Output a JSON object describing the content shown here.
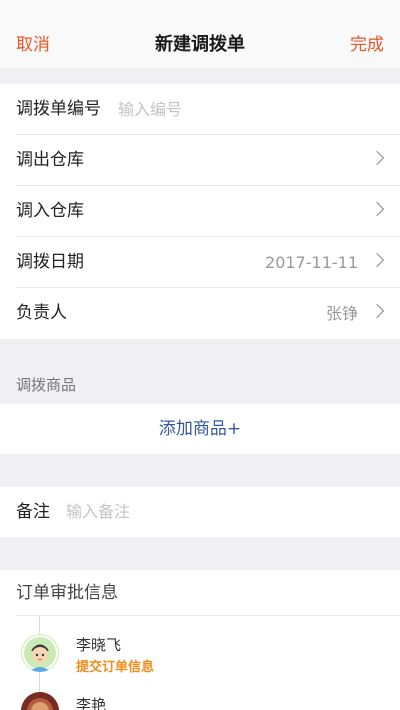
{
  "navbar": {
    "cancel_label": "取消",
    "title": "新建调拨单",
    "done_label": "完成"
  },
  "form": {
    "order_number": {
      "label": "调拨单编号",
      "placeholder": "输入编号"
    },
    "out_warehouse": {
      "label": "调出仓库"
    },
    "in_warehouse": {
      "label": "调入仓库"
    },
    "transfer_date": {
      "label": "调拨日期",
      "value": "2017-11-11"
    },
    "person_in_charge": {
      "label": "负责人",
      "value": "张铮"
    }
  },
  "goods": {
    "section_label": "调拨商品",
    "add_label": "添加商品+"
  },
  "remark": {
    "label": "备注",
    "placeholder": "输入备注"
  },
  "approval": {
    "title": "订单审批信息",
    "entries": [
      {
        "name": "李晓飞",
        "action": "提交订单信息",
        "avatar_icon": "boy-avatar-icon"
      },
      {
        "name": "李艳",
        "avatar_icon": "person-avatar-icon"
      }
    ]
  },
  "colors": {
    "accent": "#e8562a",
    "link_blue": "#35589a",
    "action_orange": "#f08c1a",
    "background": "#efeff4"
  }
}
